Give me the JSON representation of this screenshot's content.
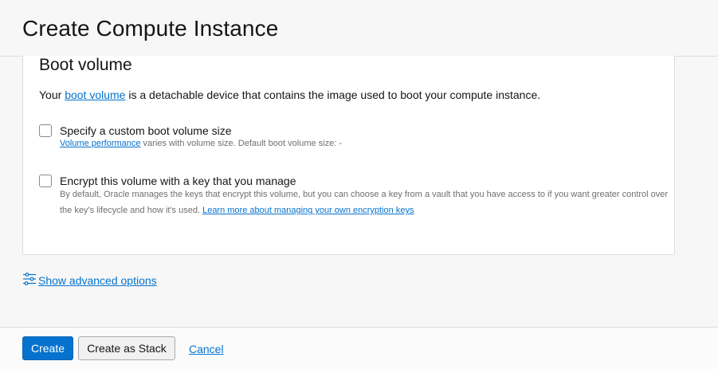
{
  "header": {
    "title": "Create Compute Instance"
  },
  "boot_volume": {
    "heading": "Boot volume",
    "intro_prefix": "Your ",
    "intro_link": "boot volume",
    "intro_suffix": " is a detachable device that contains the image used to boot your compute instance.",
    "custom_size": {
      "label": "Specify a custom boot volume size",
      "checked": false,
      "help_link": "Volume performance",
      "help_text": " varies with volume size. Default boot volume size: -"
    },
    "encrypt": {
      "label": "Encrypt this volume with a key that you manage",
      "checked": false,
      "help_text": "By default, Oracle manages the keys that encrypt this volume, but you can choose a key from a vault that you have access to if you want greater control over the key's lifecycle and how it's used. ",
      "help_link": "Learn more about managing your own encryption keys"
    }
  },
  "advanced": {
    "label": "Show advanced options",
    "icon": "sliders-icon"
  },
  "footer": {
    "create_label": "Create",
    "create_stack_label": "Create as Stack",
    "cancel_label": "Cancel"
  },
  "colors": {
    "accent": "#0572ce",
    "text": "#161513",
    "muted": "#6f6f6f"
  }
}
